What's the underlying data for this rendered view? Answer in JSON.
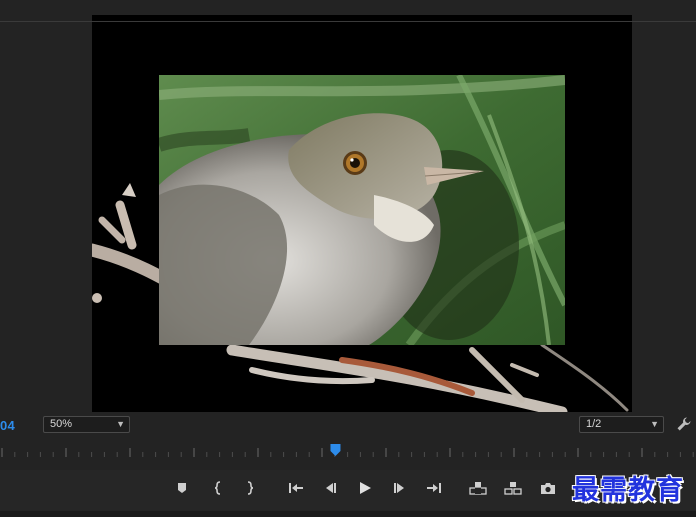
{
  "monitor": {
    "timecode": "04",
    "zoom": {
      "value": "50%",
      "icon": "chevron-down-icon"
    },
    "resolution": {
      "value": "1/2",
      "icon": "chevron-down-icon"
    },
    "settings_icon": "wrench-icon"
  },
  "timeline": {
    "playhead_fraction": 0.482,
    "playhead_color": "#2d8ceb"
  },
  "transport": [
    {
      "name": "add-marker-button",
      "icon": "marker-icon"
    },
    {
      "name": "mark-in-button",
      "icon": "mark-in-icon"
    },
    {
      "name": "mark-out-button",
      "icon": "mark-out-icon"
    },
    {
      "name": "go-to-in-button",
      "icon": "go-to-in-icon"
    },
    {
      "name": "step-back-button",
      "icon": "step-back-icon"
    },
    {
      "name": "play-button",
      "icon": "play-icon"
    },
    {
      "name": "step-forward-button",
      "icon": "step-forward-icon"
    },
    {
      "name": "go-to-out-button",
      "icon": "go-to-out-icon"
    },
    {
      "name": "lift-button",
      "icon": "lift-icon"
    },
    {
      "name": "extract-button",
      "icon": "extract-icon"
    },
    {
      "name": "export-frame-button",
      "icon": "camera-icon"
    }
  ],
  "watermark": {
    "text": "最需教育",
    "color": "#2233dd"
  },
  "colors": {
    "panel": "#232323",
    "accent": "#2d8ceb",
    "viewer": "#000000"
  }
}
